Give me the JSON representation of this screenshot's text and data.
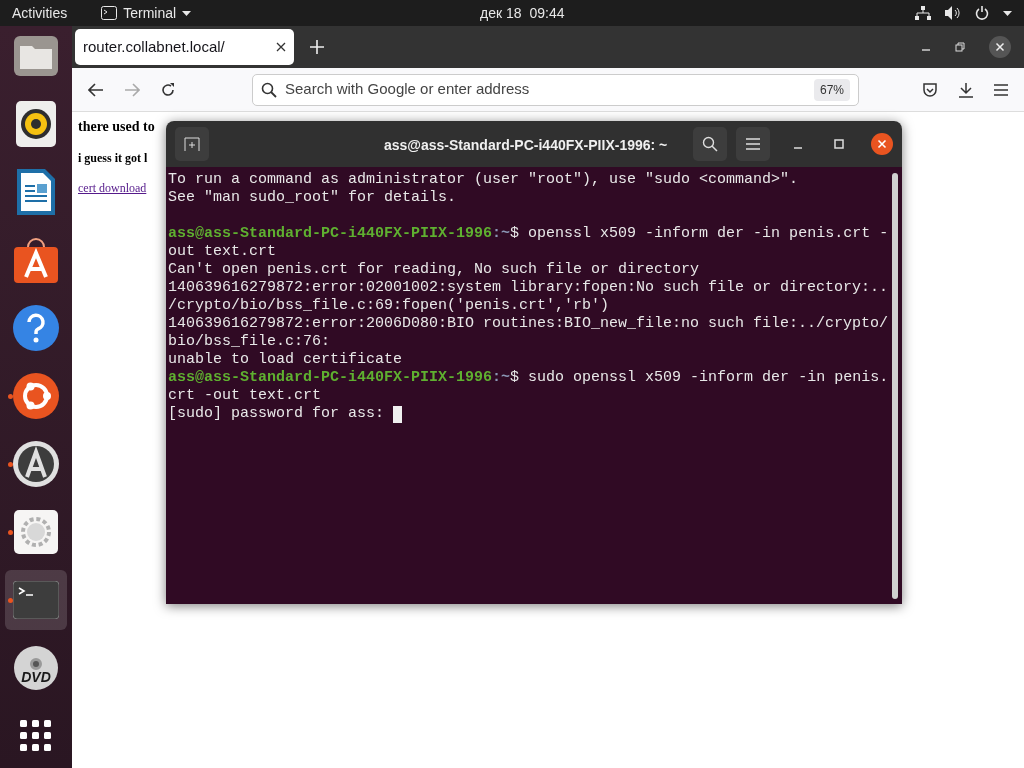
{
  "top_bar": {
    "activities": "Activities",
    "app_menu": "Terminal",
    "date": "дек 18",
    "time": "09:44"
  },
  "dock": {
    "items": [
      {
        "kind": "files",
        "running": false,
        "selected": false
      },
      {
        "kind": "music",
        "running": false,
        "selected": false
      },
      {
        "kind": "writer",
        "running": false,
        "selected": false
      },
      {
        "kind": "store",
        "running": false,
        "selected": false
      },
      {
        "kind": "help",
        "running": false,
        "selected": false
      },
      {
        "kind": "ubuntu",
        "running": true,
        "selected": false
      },
      {
        "kind": "updater",
        "running": true,
        "selected": false
      },
      {
        "kind": "settings",
        "running": true,
        "selected": false
      },
      {
        "kind": "terminal",
        "running": true,
        "selected": true
      },
      {
        "kind": "dvd",
        "label": "DVD",
        "running": false,
        "selected": false
      },
      {
        "kind": "grid",
        "running": false,
        "selected": false
      }
    ]
  },
  "browser": {
    "tabs": [
      {
        "title": "router.collabnet.local/",
        "selected": true
      }
    ],
    "address_bar": {
      "placeholder": "Search with Google or enter address",
      "zoom": "67%"
    },
    "page": {
      "heading": "there used to",
      "subheading": "i guess it got l",
      "link": "cert download"
    }
  },
  "terminal": {
    "title": "ass@ass-Standard-PC-i440FX-PIIX-1996: ~",
    "lines": [
      {
        "kind": "output",
        "text": "To run a command as administrator (user \"root\"), use \"sudo <command>\"."
      },
      {
        "kind": "output",
        "text": "See \"man sudo_root\" for details."
      },
      {
        "kind": "blank"
      },
      {
        "kind": "prompt",
        "user": "ass@ass-Standard-PC-i440FX-PIIX-1996",
        "path": ":~",
        "text": "$ openssl x509 -inform der -in penis.crt -"
      },
      {
        "kind": "output",
        "text": "out text.crt"
      },
      {
        "kind": "output",
        "text": "Can't open penis.crt for reading, No such file or directory"
      },
      {
        "kind": "output",
        "text": "140639616279872:error:02001002:system library:fopen:No such file or directory:.."
      },
      {
        "kind": "output",
        "text": "/crypto/bio/bss_file.c:69:fopen('penis.crt','rb')"
      },
      {
        "kind": "output",
        "text": "140639616279872:error:2006D080:BIO routines:BIO_new_file:no such file:../crypto/"
      },
      {
        "kind": "output",
        "text": "bio/bss_file.c:76:"
      },
      {
        "kind": "output",
        "text": "unable to load certificate"
      },
      {
        "kind": "prompt",
        "user": "ass@ass-Standard-PC-i440FX-PIIX-1996",
        "path": ":~",
        "text": "$ sudo openssl x509 -inform der -in penis."
      },
      {
        "kind": "output",
        "text": "crt -out text.crt"
      },
      {
        "kind": "output",
        "text": "[sudo] password for ass: ",
        "cursor": true
      }
    ]
  }
}
